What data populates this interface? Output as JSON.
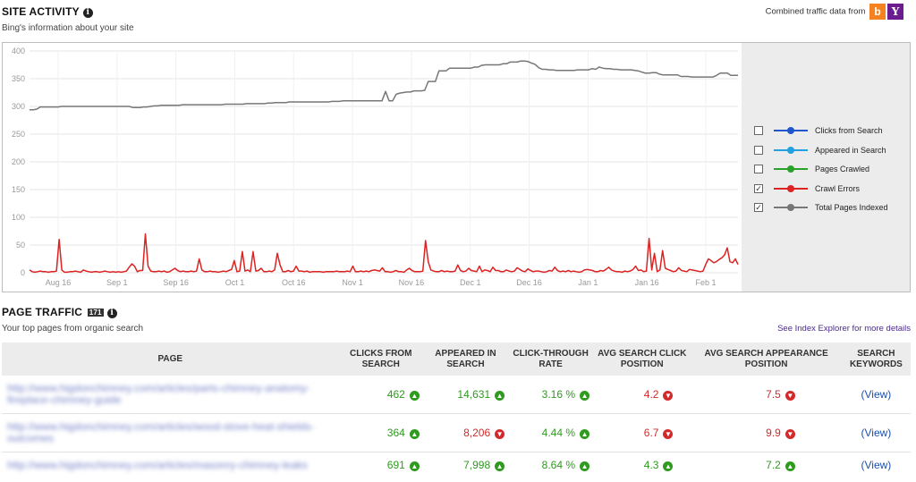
{
  "site_activity": {
    "title": "SITE ACTIVITY",
    "subtitle": "Bing's information about your site",
    "combined_label": "Combined traffic data from",
    "sources": [
      "bing-icon",
      "yahoo-icon"
    ]
  },
  "legend": {
    "items": [
      {
        "label": "Clicks from Search",
        "checked": false,
        "color": "#2255cc"
      },
      {
        "label": "Appeared in Search",
        "checked": false,
        "color": "#22a0e0"
      },
      {
        "label": "Pages Crawled",
        "checked": false,
        "color": "#2aa22a"
      },
      {
        "label": "Crawl Errors",
        "checked": true,
        "color": "#dd2222"
      },
      {
        "label": "Total Pages Indexed",
        "checked": true,
        "color": "#777777"
      }
    ]
  },
  "chart_data": {
    "type": "line",
    "ylim": [
      0,
      400
    ],
    "yticks": [
      "400",
      "350",
      "300",
      "250",
      "200",
      "150",
      "100",
      "50",
      "0"
    ],
    "x_labels": [
      "Aug 16",
      "Sep 1",
      "Sep 16",
      "Oct 1",
      "Oct 16",
      "Nov 1",
      "Nov 16",
      "Dec 1",
      "Dec 16",
      "Jan 1",
      "Jan 16",
      "Feb 1"
    ],
    "grid": true,
    "series": [
      {
        "name": "Total Pages Indexed",
        "color": "#777777",
        "values": [
          294,
          294,
          295,
          299,
          299,
          299,
          299,
          299,
          299,
          300,
          300,
          300,
          300,
          300,
          300,
          300,
          300,
          300,
          300,
          300,
          300,
          300,
          300,
          300,
          300,
          300,
          300,
          300,
          300,
          298,
          298,
          298,
          299,
          299,
          300,
          301,
          301,
          302,
          302,
          302,
          302,
          302,
          302,
          303,
          303,
          303,
          303,
          303,
          303,
          303,
          303,
          303,
          303,
          303,
          303,
          304,
          304,
          304,
          304,
          304,
          304,
          305,
          305,
          305,
          305,
          305,
          305,
          306,
          306,
          307,
          307,
          307,
          307,
          308,
          308,
          308,
          308,
          308,
          308,
          308,
          308,
          308,
          308,
          308,
          308,
          309,
          309,
          309,
          310,
          310,
          310,
          310,
          310,
          310,
          310,
          310,
          310,
          310,
          310,
          310,
          327,
          310,
          310,
          322,
          324,
          325,
          326,
          326,
          328,
          328,
          328,
          329,
          345,
          345,
          345,
          364,
          364,
          364,
          369,
          369,
          369,
          369,
          369,
          369,
          369,
          371,
          371,
          374,
          375,
          375,
          375,
          375,
          375,
          377,
          377,
          380,
          380,
          380,
          382,
          382,
          381,
          378,
          376,
          370,
          367,
          367,
          366,
          366,
          365,
          365,
          365,
          365,
          365,
          365,
          366,
          366,
          366,
          366,
          368,
          367,
          371,
          369,
          368,
          368,
          367,
          367,
          366,
          366,
          366,
          366,
          365,
          364,
          362,
          360,
          360,
          361,
          361,
          358,
          357,
          357,
          357,
          357,
          357,
          354,
          354,
          354,
          353,
          353,
          353,
          353,
          353,
          353,
          353,
          356,
          360,
          360,
          360,
          356,
          356,
          356
        ]
      },
      {
        "name": "Crawl Errors",
        "color": "#dd2222",
        "values": [
          5,
          2,
          1,
          2,
          3,
          2,
          2,
          1,
          2,
          2,
          3,
          60,
          5,
          1,
          1,
          2,
          2,
          3,
          2,
          1,
          5,
          3,
          2,
          1,
          2,
          2,
          1,
          2,
          3,
          2,
          1,
          2,
          1,
          2,
          1,
          2,
          3,
          10,
          16,
          12,
          2,
          4,
          4,
          70,
          12,
          3,
          2,
          2,
          3,
          2,
          3,
          1,
          2,
          5,
          8,
          4,
          2,
          3,
          2,
          2,
          3,
          2,
          3,
          25,
          5,
          2,
          2,
          3,
          2,
          2,
          1,
          2,
          3,
          2,
          4,
          6,
          22,
          2,
          3,
          38,
          3,
          5,
          2,
          38,
          3,
          4,
          8,
          2,
          2,
          3,
          2,
          5,
          35,
          14,
          2,
          2,
          4,
          2,
          3,
          12,
          3,
          3,
          2,
          3,
          1,
          2,
          2,
          2,
          2,
          1,
          2,
          2,
          2,
          2,
          3,
          2,
          2,
          2,
          3,
          2,
          12,
          2,
          2,
          3,
          2,
          3,
          2,
          4,
          5,
          4,
          3,
          9,
          2,
          2,
          1,
          2,
          4,
          2,
          2,
          1,
          5,
          8,
          4,
          2,
          2,
          2,
          3,
          58,
          20,
          5,
          3,
          2,
          2,
          4,
          2,
          3,
          2,
          2,
          3,
          14,
          4,
          2,
          3,
          8,
          4,
          3,
          2,
          12,
          2,
          5,
          4,
          2,
          10,
          4,
          4,
          2,
          2,
          5,
          3,
          2,
          3,
          9,
          6,
          3,
          2,
          7,
          4,
          2,
          3,
          3,
          2,
          1,
          2,
          4,
          3,
          10,
          4,
          2,
          3,
          2,
          4,
          2,
          3,
          2,
          1,
          2,
          5,
          6,
          5,
          4,
          2,
          2,
          4,
          3,
          6,
          10,
          5,
          3,
          2,
          2,
          1,
          3,
          2,
          3,
          6,
          12,
          4,
          5,
          2,
          3,
          62,
          5,
          35,
          2,
          5,
          40,
          8,
          6,
          4,
          2,
          3,
          9,
          4,
          3,
          2,
          6,
          5,
          4,
          3,
          2,
          3,
          15,
          25,
          22,
          18,
          20,
          24,
          27,
          32,
          45,
          20,
          18,
          25,
          15
        ]
      }
    ]
  },
  "page_traffic": {
    "title": "PAGE TRAFFIC",
    "badge": "171",
    "subtitle": "Your top pages from organic search",
    "index_link": "See Index Explorer for more details",
    "columns": [
      "PAGE",
      "CLICKS FROM SEARCH",
      "APPEARED IN SEARCH",
      "CLICK-THROUGH RATE",
      "AVG SEARCH CLICK POSITION",
      "AVG SEARCH APPEARANCE POSITION",
      "SEARCH KEYWORDS"
    ],
    "rows": [
      {
        "page": "http://www.higdonchimney.com/articles/parts-chimney-anatomy-fireplace-chimney-guide",
        "clicks": "462",
        "clicks_trend": "up",
        "appeared": "14,631",
        "appeared_trend": "up",
        "ctr": "3.16 %",
        "ctr_trend": "up",
        "click_pos": "4.2",
        "click_pos_trend": "down",
        "appear_pos": "7.5",
        "appear_pos_trend": "down",
        "keywords": "(View)"
      },
      {
        "page": "http://www.higdonchimney.com/articles/wood-stove-heat-shields-outcomes",
        "clicks": "364",
        "clicks_trend": "up",
        "appeared": "8,206",
        "appeared_trend": "down",
        "ctr": "4.44 %",
        "ctr_trend": "up",
        "click_pos": "6.7",
        "click_pos_trend": "down",
        "appear_pos": "9.9",
        "appear_pos_trend": "down",
        "keywords": "(View)"
      },
      {
        "page": "http://www.higdonchimney.com/articles/masonry-chimney-leaks",
        "clicks": "691",
        "clicks_trend": "up",
        "appeared": "7,998",
        "appeared_trend": "up",
        "ctr": "8.64 %",
        "ctr_trend": "up",
        "click_pos": "4.3",
        "click_pos_trend": "up",
        "appear_pos": "7.2",
        "appear_pos_trend": "up",
        "keywords": "(View)"
      }
    ]
  }
}
